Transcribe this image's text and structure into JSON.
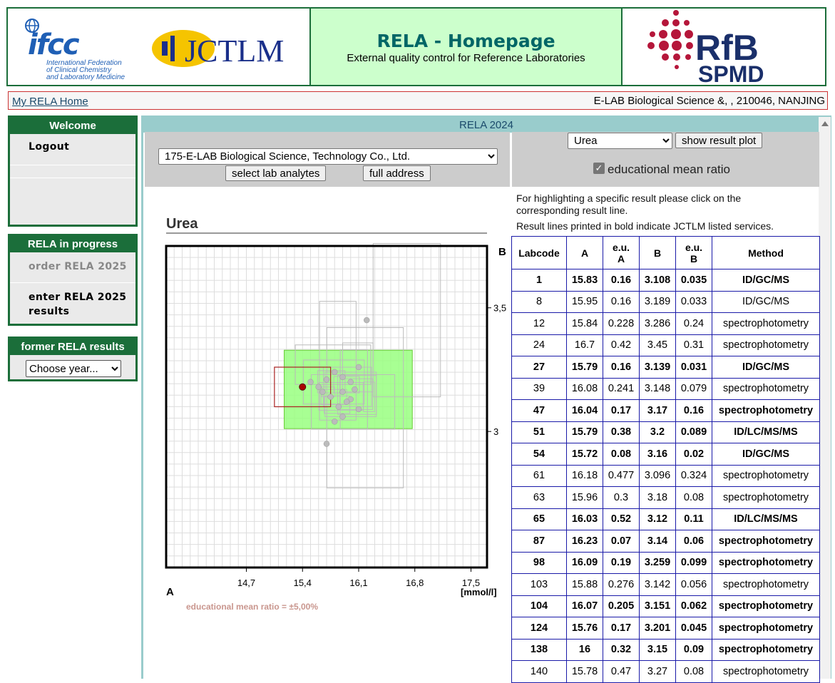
{
  "header": {
    "title": "RELA - Homepage",
    "subtitle": "External quality control for Reference Laboratories",
    "ifcc_logo": {
      "word": "ifcc",
      "text": [
        "International Federation",
        "of Clinical Chemistry",
        "and Laboratory Medicine"
      ]
    },
    "jctlm_logo": {
      "text": "JCTLM"
    },
    "rfb_logo": {
      "line1": "RfB",
      "line2": "SPMD"
    }
  },
  "nav": {
    "home_link": "My RELA Home",
    "lab_address": "E-LAB Biological Science &, , 210046, NANJING"
  },
  "sidebar": {
    "welcome": {
      "title": "Welcome",
      "logout": "Logout"
    },
    "progress": {
      "title": "RELA in progress",
      "order": "order RELA 2025",
      "enter_line1": "enter RELA 2025",
      "enter_line2": "results"
    },
    "former": {
      "title": "former RELA results",
      "select_value": "Choose year..."
    }
  },
  "main": {
    "title": "RELA 2024",
    "lab_select_value": "175-E-LAB Biological Science, Technology Co., Ltd.",
    "select_analytes_btn": "select lab analytes",
    "full_address_btn": "full address",
    "analyte_select_value": "Urea",
    "show_plot_btn": "show result plot",
    "edu_checkbox_label": "educational mean ratio",
    "edu_checked": true,
    "note1_line1": "For highlighting a specific result please click on the",
    "note1_line2": "corresponding result line.",
    "note2": "Result lines printed in bold indicate JCTLM listed services."
  },
  "colors": {
    "dark_green": "#1b6e3a",
    "title_teal": "#006666",
    "light_green": "#ccffcc",
    "table_border": "#1a1aa8",
    "panel_teal": "#99cccc"
  },
  "chart_data": {
    "type": "scatter",
    "title": "Urea",
    "xlabel": "A",
    "ylabel": "B",
    "unit": "[mmol/l]",
    "x_ticks": [
      "14,7",
      "15,4",
      "16,1",
      "16,8",
      "17,5"
    ],
    "y_ticks": [
      "3,5",
      "3"
    ],
    "xlim": [
      13.7,
      17.7
    ],
    "ylim": [
      2.45,
      3.75
    ],
    "annotation": "educational mean ratio = ±5,00%",
    "highlight": {
      "x": 15.4,
      "y": 3.18
    },
    "points": [
      {
        "x": 16.2,
        "y": 3.45
      },
      {
        "x": 15.5,
        "y": 3.2
      },
      {
        "x": 15.6,
        "y": 3.18
      },
      {
        "x": 15.7,
        "y": 3.21
      },
      {
        "x": 15.8,
        "y": 3.24
      },
      {
        "x": 15.9,
        "y": 3.16
      },
      {
        "x": 16.0,
        "y": 3.13
      },
      {
        "x": 16.05,
        "y": 3.17
      },
      {
        "x": 15.95,
        "y": 3.12
      },
      {
        "x": 15.85,
        "y": 3.1
      },
      {
        "x": 16.1,
        "y": 3.09
      },
      {
        "x": 15.75,
        "y": 3.14
      },
      {
        "x": 15.65,
        "y": 3.16
      },
      {
        "x": 16.0,
        "y": 3.2
      },
      {
        "x": 15.9,
        "y": 3.06
      },
      {
        "x": 15.8,
        "y": 3.04
      },
      {
        "x": 16.1,
        "y": 3.26
      },
      {
        "x": 15.7,
        "y": 2.95
      },
      {
        "x": 15.9,
        "y": 3.22
      }
    ]
  },
  "table": {
    "headers": {
      "labcode": "Labcode",
      "a": "A",
      "eua_1": "e.u.",
      "eua_2": "A",
      "b": "B",
      "eub_1": "e.u.",
      "eub_2": "B",
      "method": "Method"
    },
    "rows": [
      {
        "labcode": "1",
        "a": "15.83",
        "eua": "0.16",
        "b": "3.108",
        "eub": "0.035",
        "method": "ID/GC/MS",
        "bold": true
      },
      {
        "labcode": "8",
        "a": "15.95",
        "eua": "0.16",
        "b": "3.189",
        "eub": "0.033",
        "method": "ID/GC/MS",
        "bold": false
      },
      {
        "labcode": "12",
        "a": "15.84",
        "eua": "0.228",
        "b": "3.286",
        "eub": "0.24",
        "method": "spectrophotometry",
        "bold": false
      },
      {
        "labcode": "24",
        "a": "16.7",
        "eua": "0.42",
        "b": "3.45",
        "eub": "0.31",
        "method": "spectrophotometry",
        "bold": false
      },
      {
        "labcode": "27",
        "a": "15.79",
        "eua": "0.16",
        "b": "3.139",
        "eub": "0.031",
        "method": "ID/GC/MS",
        "bold": true
      },
      {
        "labcode": "39",
        "a": "16.08",
        "eua": "0.241",
        "b": "3.148",
        "eub": "0.079",
        "method": "spectrophotometry",
        "bold": false
      },
      {
        "labcode": "47",
        "a": "16.04",
        "eua": "0.17",
        "b": "3.17",
        "eub": "0.16",
        "method": "spectrophotometry",
        "bold": true
      },
      {
        "labcode": "51",
        "a": "15.79",
        "eua": "0.38",
        "b": "3.2",
        "eub": "0.089",
        "method": "ID/LC/MS/MS",
        "bold": true
      },
      {
        "labcode": "54",
        "a": "15.72",
        "eua": "0.08",
        "b": "3.16",
        "eub": "0.02",
        "method": "ID/GC/MS",
        "bold": true
      },
      {
        "labcode": "61",
        "a": "16.18",
        "eua": "0.477",
        "b": "3.096",
        "eub": "0.324",
        "method": "spectrophotometry",
        "bold": false
      },
      {
        "labcode": "63",
        "a": "15.96",
        "eua": "0.3",
        "b": "3.18",
        "eub": "0.08",
        "method": "spectrophotometry",
        "bold": false
      },
      {
        "labcode": "65",
        "a": "16.03",
        "eua": "0.52",
        "b": "3.12",
        "eub": "0.11",
        "method": "ID/LC/MS/MS",
        "bold": true
      },
      {
        "labcode": "87",
        "a": "16.23",
        "eua": "0.07",
        "b": "3.14",
        "eub": "0.06",
        "method": "spectrophotometry",
        "bold": true
      },
      {
        "labcode": "98",
        "a": "16.09",
        "eua": "0.19",
        "b": "3.259",
        "eub": "0.099",
        "method": "spectrophotometry",
        "bold": true
      },
      {
        "labcode": "103",
        "a": "15.88",
        "eua": "0.276",
        "b": "3.142",
        "eub": "0.056",
        "method": "spectrophotometry",
        "bold": false
      },
      {
        "labcode": "104",
        "a": "16.07",
        "eua": "0.205",
        "b": "3.151",
        "eub": "0.062",
        "method": "spectrophotometry",
        "bold": true
      },
      {
        "labcode": "124",
        "a": "15.76",
        "eua": "0.17",
        "b": "3.201",
        "eub": "0.045",
        "method": "spectrophotometry",
        "bold": true
      },
      {
        "labcode": "138",
        "a": "16",
        "eua": "0.32",
        "b": "3.15",
        "eub": "0.09",
        "method": "spectrophotometry",
        "bold": true
      },
      {
        "labcode": "140",
        "a": "15.78",
        "eua": "0.47",
        "b": "3.27",
        "eub": "0.08",
        "method": "spectrophotometry",
        "bold": false
      }
    ]
  }
}
